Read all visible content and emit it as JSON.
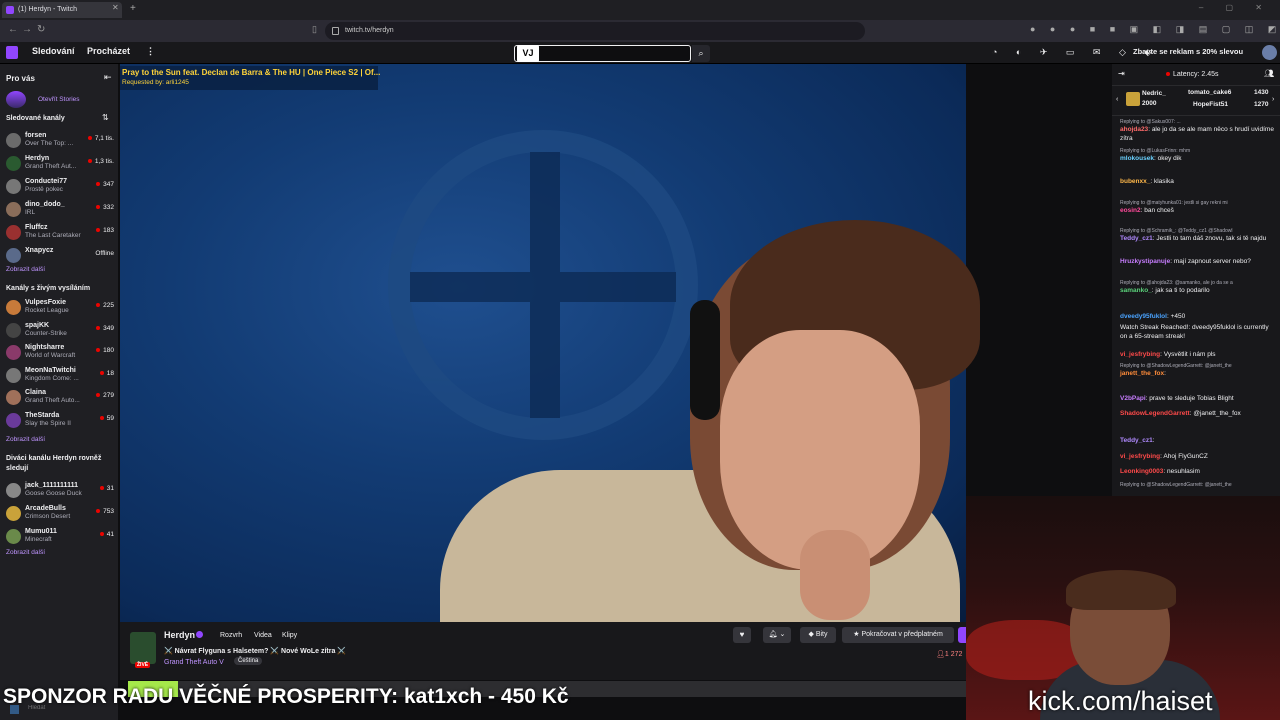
{
  "browser": {
    "tab_title": "(1) Herdyn - Twitch",
    "url": "twitch.tv/herdyn"
  },
  "topnav": {
    "following": "Sledování",
    "browse": "Procházet",
    "search_badge": "VJ",
    "promo": "Zbavte se reklam s 20% slevou"
  },
  "sidebar": {
    "for_you": "Pro vás",
    "stories": "Otevřít Stories",
    "followed_header": "Sledované kanály",
    "followed": [
      {
        "name": "forsen",
        "game": "Over The Top: ...",
        "viewers": "7,1 tis.",
        "color": "#6b6b6b"
      },
      {
        "name": "Herdyn",
        "game": "Grand Theft Aut...",
        "viewers": "1,3 tis.",
        "color": "#2a5a30"
      },
      {
        "name": "Conductei77",
        "game": "Prostě pokec",
        "viewers": "347",
        "color": "#777"
      },
      {
        "name": "dino_dodo_",
        "game": "IRL",
        "viewers": "332",
        "color": "#8a6d5a"
      },
      {
        "name": "Fluffcz",
        "game": "The Last Caretaker",
        "viewers": "183",
        "color": "#9a3030"
      },
      {
        "name": "Xnapycz",
        "game": "",
        "viewers": "Offline",
        "color": "#5a6a8a"
      }
    ],
    "show_more_1": "Zobrazit další",
    "live_header": "Kanály s živým vysíláním",
    "live": [
      {
        "name": "VulpesFoxie",
        "game": "Rocket League",
        "viewers": "225",
        "color": "#c77a3a"
      },
      {
        "name": "spajKK",
        "game": "Counter-Strike",
        "viewers": "349",
        "color": "#444"
      },
      {
        "name": "Nightsharre",
        "game": "World of Warcraft",
        "viewers": "180",
        "color": "#8a3a6a"
      },
      {
        "name": "MeonNaTwitchi",
        "game": "Kingdom Come: ...",
        "viewers": "18",
        "color": "#777"
      },
      {
        "name": "Claina",
        "game": "Grand Theft Auto...",
        "viewers": "279",
        "color": "#a0705a"
      },
      {
        "name": "TheStarda",
        "game": "Slay the Spire II",
        "viewers": "59",
        "color": "#6a3a9a"
      }
    ],
    "show_more_2": "Zobrazit další",
    "viewers_header_1": "Diváci kanálu Herdyn rovněž",
    "viewers_header_2": "sledují",
    "also": [
      {
        "name": "jack_1111111111",
        "game": "Goose Goose Duck",
        "viewers": "31",
        "color": "#888"
      },
      {
        "name": "ArcadeBulls",
        "game": "Crimson Desert",
        "viewers": "753",
        "color": "#c9a23a"
      },
      {
        "name": "Mumu011",
        "game": "Minecraft",
        "viewers": "41",
        "color": "#6a8a4a"
      }
    ],
    "show_more_3": "Zobrazit další"
  },
  "video": {
    "song_title": "Pray to the Sun feat. Declan de Barra & The HU | One Piece S2 | Of...",
    "song_requester": "Requested by: arli1245"
  },
  "channel": {
    "name": "Herdyn",
    "tab_schedule": "Rozvrh",
    "tab_videos": "Videa",
    "tab_clips": "Klipy",
    "stream_title": "⚔️ Návrat Flyguna s Halsetem? ⚔️ Nové WoLe zítra ⚔️",
    "game": "Grand Theft Auto V",
    "language": "Čeština",
    "live_badge": "ŽIVĚ",
    "bits": "Bity",
    "subscribe": "Pokračovat v předplatném",
    "viewers": "1 272"
  },
  "chat": {
    "latency": "Latency: 2.45s",
    "gifts": [
      {
        "name": "Nedric_",
        "amount": "2000"
      },
      {
        "name": "tomato_cake6",
        "amount": "1430"
      },
      {
        "name": "HopeFist51",
        "amount": "1270"
      }
    ],
    "messages": [
      {
        "reply": "Replying to @Sakus007: ...",
        "user": "ahojda23",
        "color": "#ff6b6b",
        "text": "ale jo da se ale mam něco s hrudí uvidíme zítra"
      },
      {
        "reply": "Replying to @LukasFrinn: mhm",
        "user": "mlokousek",
        "color": "#6ad1ff",
        "text": "okey dik"
      },
      {
        "reply": "",
        "user": "bubenxx_",
        "color": "#ffb84a",
        "text": "klasika"
      },
      {
        "reply": "Replying to @matyhunka01: jestli si gay rekni mi",
        "user": "eosin2",
        "color": "#ff4a9a",
        "text": "ban chceš"
      },
      {
        "reply": "Replying to @Schramik_: @Teddy_cz1 @Shadowl",
        "user": "Teddy_cz1",
        "color": "#b08aff",
        "text": "Jestli to tam dáš znovu, tak si tě najdu"
      },
      {
        "reply": "",
        "user": "Hruzkystipanuje",
        "color": "#c77dff",
        "text": "mají zapnout server nebo?"
      },
      {
        "reply": "Replying to @ahojda23: @samanko, ale jo da se a",
        "user": "samanko_",
        "color": "#5ad17a",
        "text": "jak sa ti to podarilo"
      },
      {
        "reply": "",
        "user": "dveedy95fuklol",
        "color": "#4aa3ff",
        "text": "+450"
      },
      {
        "reply": "",
        "user": "",
        "color": "#efeff1",
        "text": "Watch Streak Reached!: dveedy95fuklol is currently on a 65-stream streak!"
      },
      {
        "reply": "",
        "user": "vi_jesfrybing",
        "color": "#ff4a4a",
        "text": "Vysvětlit i nám pls"
      },
      {
        "reply": "Replying to @ShadowLegendGarrett: @janett_the",
        "user": "janett_the_fox",
        "color": "#ff8c3a",
        "text": ""
      },
      {
        "reply": "",
        "user": "V2bPapi",
        "color": "#c77dff",
        "text": "prave te sleduje Tobias Blight"
      },
      {
        "reply": "",
        "user": "ShadowLegendGarrett",
        "color": "#ff4a4a",
        "text": "@janett_the_fox"
      },
      {
        "reply": "",
        "user": "Teddy_cz1",
        "color": "#b08aff",
        "text": ""
      },
      {
        "reply": "",
        "user": "vi_jesfrybing",
        "color": "#ff4a4a",
        "text": "Ahoj FlyGunCZ"
      },
      {
        "reply": "",
        "user": "Leonking0003",
        "color": "#ff4a4a",
        "text": "nesuhlasim"
      },
      {
        "reply": "Replying to @ShadowLegendGarrett: @janett_the",
        "user": "",
        "color": "#adadb8",
        "text": ""
      }
    ]
  },
  "overlay": {
    "sponsor": "SPONZOR RADU VĚČNÉ PROSPERITY: kat1xch - 450 Kč",
    "kick": "kick.com/haiset",
    "taskbar_search": "Hledat"
  }
}
